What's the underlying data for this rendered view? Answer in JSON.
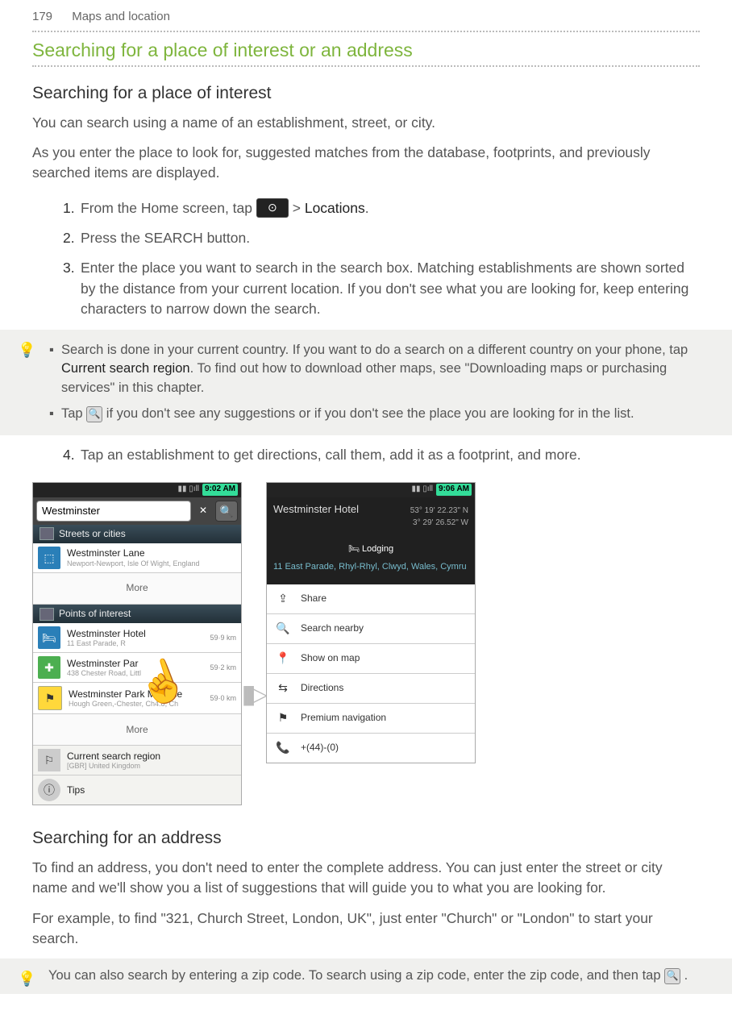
{
  "page": {
    "number": "179",
    "chapter": "Maps and location"
  },
  "h1": "Searching for a place of interest or an address",
  "s1": {
    "title": "Searching for a place of interest",
    "p1": "You can search using a name of an establishment, street, or city.",
    "p2": "As you enter the place to look for, suggested matches from the database, footprints, and previously searched items are displayed.",
    "step1_a": "From the Home screen, tap ",
    "step1_b": " > ",
    "step1_c": "Locations",
    "step1_d": ".",
    "step2": "Press the SEARCH button.",
    "step3": "Enter the place you want to search in the search box. Matching establishments are shown sorted by the distance from your current location. If you don't see what you are looking for, keep entering characters to narrow down the search.",
    "step4": "Tap an establishment to get directions, call them, add it as a footprint, and more."
  },
  "tip1": {
    "b1a": "Search is done in your current country. If you want to do a search on a different country on your phone, tap ",
    "b1b": "Current search region",
    "b1c": ". To find out how to download other maps, see \"Downloading maps or purchasing services\" in this chapter.",
    "b2a": "Tap ",
    "b2b": " if you don't see any suggestions or if you don't see the place you are looking for in the list."
  },
  "s2": {
    "title": "Searching for an address",
    "p1": "To find an address, you don't need to enter the complete address. You can just enter the street or city name and we'll show you a list of suggestions that will guide you to what you are looking for.",
    "p2": "For example, to find \"321, Church Street, London, UK\", just enter \"Church\" or \"London\" to start your search."
  },
  "tip2": {
    "a": "You can also search by entering a zip code. To search using a zip code, enter the zip code, and then tap ",
    "b": " ."
  },
  "phone1": {
    "time": "9:02 AM",
    "search": "Westminster",
    "hdr1": "Streets or cities",
    "r1": {
      "main": "Westminster Lane",
      "sub": "Newport-Newport, Isle Of Wight, England"
    },
    "more1": "More",
    "hdr2": "Points of interest",
    "r2": {
      "main": "Westminster Hotel",
      "sub": "11 East Parade, R",
      "dist": "59·9 km"
    },
    "r3": {
      "main": "Westminster Par",
      "sub": "438 Chester Road, Littl",
      "dist": "59·2 km"
    },
    "r4": {
      "main": "Westminster Park M",
      "sub": "Hough Green,-Chester, Ch4.8, Ch",
      "addon": "rse",
      "dist": "59·0 km"
    },
    "more2": "More",
    "r5": {
      "main": "Current search region",
      "sub": "[GBR] United Kingdom"
    },
    "r6": {
      "main": "Tips"
    }
  },
  "phone2": {
    "time": "9:06 AM",
    "title": "Westminster Hotel",
    "coord1": "53° 19' 22.23\" N",
    "coord2": "3° 29' 26.52\" W",
    "lodging": "Lodging",
    "addr": "11 East Parade, Rhyl-Rhyl, Clwyd, Wales, Cymru",
    "a1": "Share",
    "a2": "Search nearby",
    "a3": "Show on map",
    "a4": "Directions",
    "a5": "Premium navigation",
    "a6": "+(44)-(0)"
  }
}
